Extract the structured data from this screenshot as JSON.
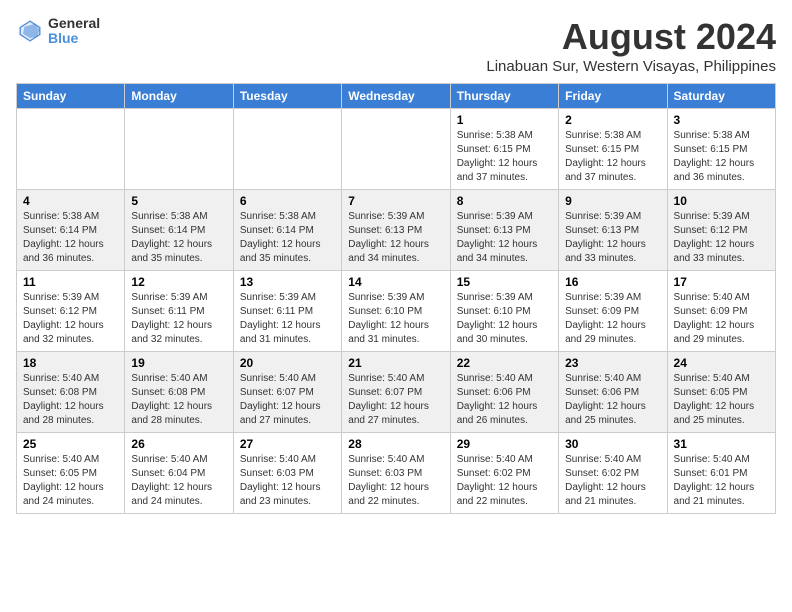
{
  "logo": {
    "general": "General",
    "blue": "Blue"
  },
  "title": "August 2024",
  "subtitle": "Linabuan Sur, Western Visayas, Philippines",
  "days_of_week": [
    "Sunday",
    "Monday",
    "Tuesday",
    "Wednesday",
    "Thursday",
    "Friday",
    "Saturday"
  ],
  "weeks": [
    [
      {
        "day": "",
        "info": ""
      },
      {
        "day": "",
        "info": ""
      },
      {
        "day": "",
        "info": ""
      },
      {
        "day": "",
        "info": ""
      },
      {
        "day": "1",
        "info": "Sunrise: 5:38 AM\nSunset: 6:15 PM\nDaylight: 12 hours\nand 37 minutes."
      },
      {
        "day": "2",
        "info": "Sunrise: 5:38 AM\nSunset: 6:15 PM\nDaylight: 12 hours\nand 37 minutes."
      },
      {
        "day": "3",
        "info": "Sunrise: 5:38 AM\nSunset: 6:15 PM\nDaylight: 12 hours\nand 36 minutes."
      }
    ],
    [
      {
        "day": "4",
        "info": "Sunrise: 5:38 AM\nSunset: 6:14 PM\nDaylight: 12 hours\nand 36 minutes."
      },
      {
        "day": "5",
        "info": "Sunrise: 5:38 AM\nSunset: 6:14 PM\nDaylight: 12 hours\nand 35 minutes."
      },
      {
        "day": "6",
        "info": "Sunrise: 5:38 AM\nSunset: 6:14 PM\nDaylight: 12 hours\nand 35 minutes."
      },
      {
        "day": "7",
        "info": "Sunrise: 5:39 AM\nSunset: 6:13 PM\nDaylight: 12 hours\nand 34 minutes."
      },
      {
        "day": "8",
        "info": "Sunrise: 5:39 AM\nSunset: 6:13 PM\nDaylight: 12 hours\nand 34 minutes."
      },
      {
        "day": "9",
        "info": "Sunrise: 5:39 AM\nSunset: 6:13 PM\nDaylight: 12 hours\nand 33 minutes."
      },
      {
        "day": "10",
        "info": "Sunrise: 5:39 AM\nSunset: 6:12 PM\nDaylight: 12 hours\nand 33 minutes."
      }
    ],
    [
      {
        "day": "11",
        "info": "Sunrise: 5:39 AM\nSunset: 6:12 PM\nDaylight: 12 hours\nand 32 minutes."
      },
      {
        "day": "12",
        "info": "Sunrise: 5:39 AM\nSunset: 6:11 PM\nDaylight: 12 hours\nand 32 minutes."
      },
      {
        "day": "13",
        "info": "Sunrise: 5:39 AM\nSunset: 6:11 PM\nDaylight: 12 hours\nand 31 minutes."
      },
      {
        "day": "14",
        "info": "Sunrise: 5:39 AM\nSunset: 6:10 PM\nDaylight: 12 hours\nand 31 minutes."
      },
      {
        "day": "15",
        "info": "Sunrise: 5:39 AM\nSunset: 6:10 PM\nDaylight: 12 hours\nand 30 minutes."
      },
      {
        "day": "16",
        "info": "Sunrise: 5:39 AM\nSunset: 6:09 PM\nDaylight: 12 hours\nand 29 minutes."
      },
      {
        "day": "17",
        "info": "Sunrise: 5:40 AM\nSunset: 6:09 PM\nDaylight: 12 hours\nand 29 minutes."
      }
    ],
    [
      {
        "day": "18",
        "info": "Sunrise: 5:40 AM\nSunset: 6:08 PM\nDaylight: 12 hours\nand 28 minutes."
      },
      {
        "day": "19",
        "info": "Sunrise: 5:40 AM\nSunset: 6:08 PM\nDaylight: 12 hours\nand 28 minutes."
      },
      {
        "day": "20",
        "info": "Sunrise: 5:40 AM\nSunset: 6:07 PM\nDaylight: 12 hours\nand 27 minutes."
      },
      {
        "day": "21",
        "info": "Sunrise: 5:40 AM\nSunset: 6:07 PM\nDaylight: 12 hours\nand 27 minutes."
      },
      {
        "day": "22",
        "info": "Sunrise: 5:40 AM\nSunset: 6:06 PM\nDaylight: 12 hours\nand 26 minutes."
      },
      {
        "day": "23",
        "info": "Sunrise: 5:40 AM\nSunset: 6:06 PM\nDaylight: 12 hours\nand 25 minutes."
      },
      {
        "day": "24",
        "info": "Sunrise: 5:40 AM\nSunset: 6:05 PM\nDaylight: 12 hours\nand 25 minutes."
      }
    ],
    [
      {
        "day": "25",
        "info": "Sunrise: 5:40 AM\nSunset: 6:05 PM\nDaylight: 12 hours\nand 24 minutes."
      },
      {
        "day": "26",
        "info": "Sunrise: 5:40 AM\nSunset: 6:04 PM\nDaylight: 12 hours\nand 24 minutes."
      },
      {
        "day": "27",
        "info": "Sunrise: 5:40 AM\nSunset: 6:03 PM\nDaylight: 12 hours\nand 23 minutes."
      },
      {
        "day": "28",
        "info": "Sunrise: 5:40 AM\nSunset: 6:03 PM\nDaylight: 12 hours\nand 22 minutes."
      },
      {
        "day": "29",
        "info": "Sunrise: 5:40 AM\nSunset: 6:02 PM\nDaylight: 12 hours\nand 22 minutes."
      },
      {
        "day": "30",
        "info": "Sunrise: 5:40 AM\nSunset: 6:02 PM\nDaylight: 12 hours\nand 21 minutes."
      },
      {
        "day": "31",
        "info": "Sunrise: 5:40 AM\nSunset: 6:01 PM\nDaylight: 12 hours\nand 21 minutes."
      }
    ]
  ]
}
